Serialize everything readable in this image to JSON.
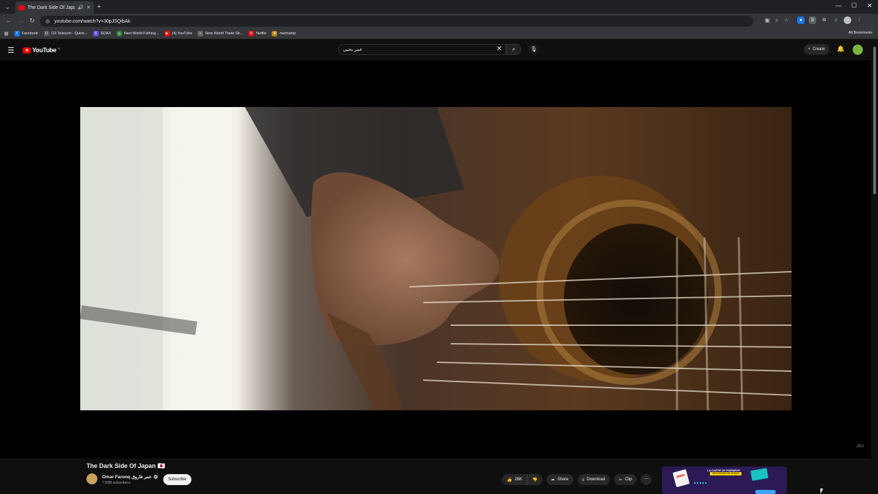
{
  "browser": {
    "tab": {
      "title": "The Dark Side Of Japan 🇯🇵",
      "audio_icon": "speaker-icon",
      "close": "✕"
    },
    "new_tab": "+",
    "window_controls": [
      "—",
      "☐",
      "✕"
    ],
    "url": "youtube.com/watch?v=30pJSQibAk",
    "bookmarks": [
      {
        "label": "Facebook",
        "color": "#1877f2",
        "glyph": "f"
      },
      {
        "label": "O3 Telecom - Quick...",
        "color": "#555555",
        "glyph": "O"
      },
      {
        "label": "SOAX",
        "color": "#5b4fe0",
        "glyph": "S"
      },
      {
        "label": "New World Fishing...",
        "color": "#2e7d32",
        "glyph": "◎"
      },
      {
        "label": "(4) YouTube",
        "color": "#ff0000",
        "glyph": "▶"
      },
      {
        "label": "New World Trade Sk...",
        "color": "#666666",
        "glyph": "◐"
      },
      {
        "label": "Netflix",
        "color": "#e50914",
        "glyph": "N"
      },
      {
        "label": "nwchamp",
        "color": "#b8860b",
        "glyph": "♛"
      }
    ],
    "all_bookmarks": "All Bookmarks"
  },
  "youtube": {
    "logo_text": "YouTube",
    "logo_country": "IQ",
    "search": {
      "value": "عمر يحيى"
    },
    "create_label": "Create"
  },
  "video": {
    "title": "The Dark Side Of Japan 🇯🇵",
    "channel": "Omar Farooq عمر فاروق",
    "subscribers": "7.99M subscribers",
    "subscribe_label": "Subscribe",
    "likes": "26K",
    "share_label": "Share",
    "download_label": "Download",
    "clip_label": "Clip",
    "ad_text_1": "LA CARTE DE PAIEMENT",
    "ad_text_2": "DES MOINS DE 18 ANS"
  }
}
